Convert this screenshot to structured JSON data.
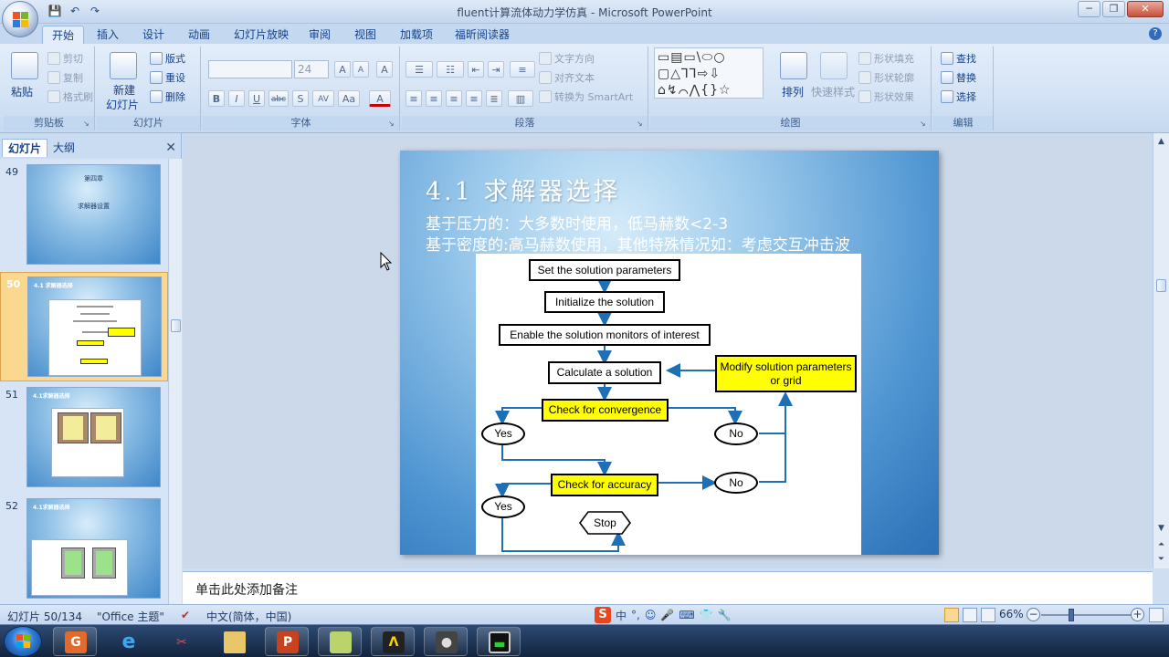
{
  "window": {
    "title": "fluent计算流体动力学仿真 - Microsoft PowerPoint",
    "minimize": "─",
    "restore": "❐",
    "close": "✕"
  },
  "qat": {
    "save": "💾",
    "undo": "↶",
    "redo": "↷"
  },
  "tabs": [
    "开始",
    "插入",
    "设计",
    "动画",
    "幻灯片放映",
    "审阅",
    "视图",
    "加载项",
    "福昕阅读器"
  ],
  "active_tab": "开始",
  "help": "?",
  "ribbon": {
    "clipboard": {
      "label": "剪贴板",
      "paste": "粘贴",
      "cut": "剪切",
      "copy": "复制",
      "format_painter": "格式刷"
    },
    "slides": {
      "label": "幻灯片",
      "new_slide_1": "新建",
      "new_slide_2": "幻灯片",
      "layout": "版式",
      "reset": "重设",
      "delete": "删除"
    },
    "font": {
      "label": "字体",
      "font_name": "",
      "font_size": "24",
      "grow": "A",
      "shrink": "A",
      "clear": "A",
      "bold": "B",
      "italic": "I",
      "underline": "U",
      "strike": "abc",
      "shadow": "S",
      "spacing": "AV",
      "case": "Aa",
      "color": "A"
    },
    "paragraph": {
      "label": "段落",
      "text_direction": "文字方向",
      "align_text": "对齐文本",
      "smartart": "转换为 SmartArt"
    },
    "drawing": {
      "label": "绘图",
      "arrange": "排列",
      "quick_styles": "快速样式",
      "shape_fill": "形状填充",
      "shape_outline": "形状轮廓",
      "shape_effects": "形状效果",
      "shapes_glyphs": "▭▤▭\\⬭○ ▢△⅂⅂⇨⇩ ⌂↯⌒⋀{}☆"
    },
    "editing": {
      "label": "编辑",
      "find": "查找",
      "replace": "替换",
      "select": "选择"
    }
  },
  "left_panel": {
    "tab_slides": "幻灯片",
    "tab_outline": "大纲",
    "close": "✕",
    "thumbnails": [
      {
        "num": "49",
        "line1": "第四章",
        "line2": "求解器设置"
      },
      {
        "num": "50",
        "title": "4.1 求解器选择"
      },
      {
        "num": "51",
        "title": "4.1求解器选择"
      },
      {
        "num": "52",
        "title": "4.1求解器选择"
      }
    ]
  },
  "slide": {
    "title": "4.1 求解器选择",
    "line1": "基于压力的：大多数时使用，低马赫数<2-3",
    "line2": "基于密度的:高马赫数使用，其他特殊情况如：考虑交互冲击波",
    "flowchart": {
      "n1": "Set the solution parameters",
      "n2": "Initialize the solution",
      "n3": "Enable the solution monitors of interest",
      "n4": "Calculate a solution",
      "n5": "Check for convergence",
      "n6": "Modify solution parameters or grid",
      "yes1": "Yes",
      "no1": "No",
      "n7": "Check for accuracy",
      "no2": "No",
      "yes2": "Yes",
      "stop": "Stop"
    }
  },
  "notes": {
    "placeholder": "单击此处添加备注"
  },
  "status": {
    "slide_count": "幻灯片 50/134",
    "theme": "\"Office 主题\"",
    "language": "中文(简体，中国)",
    "zoom": "66%",
    "ime": {
      "logo": "S",
      "mode": "中",
      "punct": "°,",
      "emoji": "☺",
      "mic": "🎤",
      "kb": "⌨",
      "skin": "👕",
      "tools": "🔧"
    }
  },
  "taskbar": {
    "apps": [
      "pdf-app",
      "internet-explorer",
      "tool-app",
      "file-explorer",
      "powerpoint",
      "sticky-app",
      "media-app",
      "camera-app",
      "monitor-app"
    ]
  }
}
